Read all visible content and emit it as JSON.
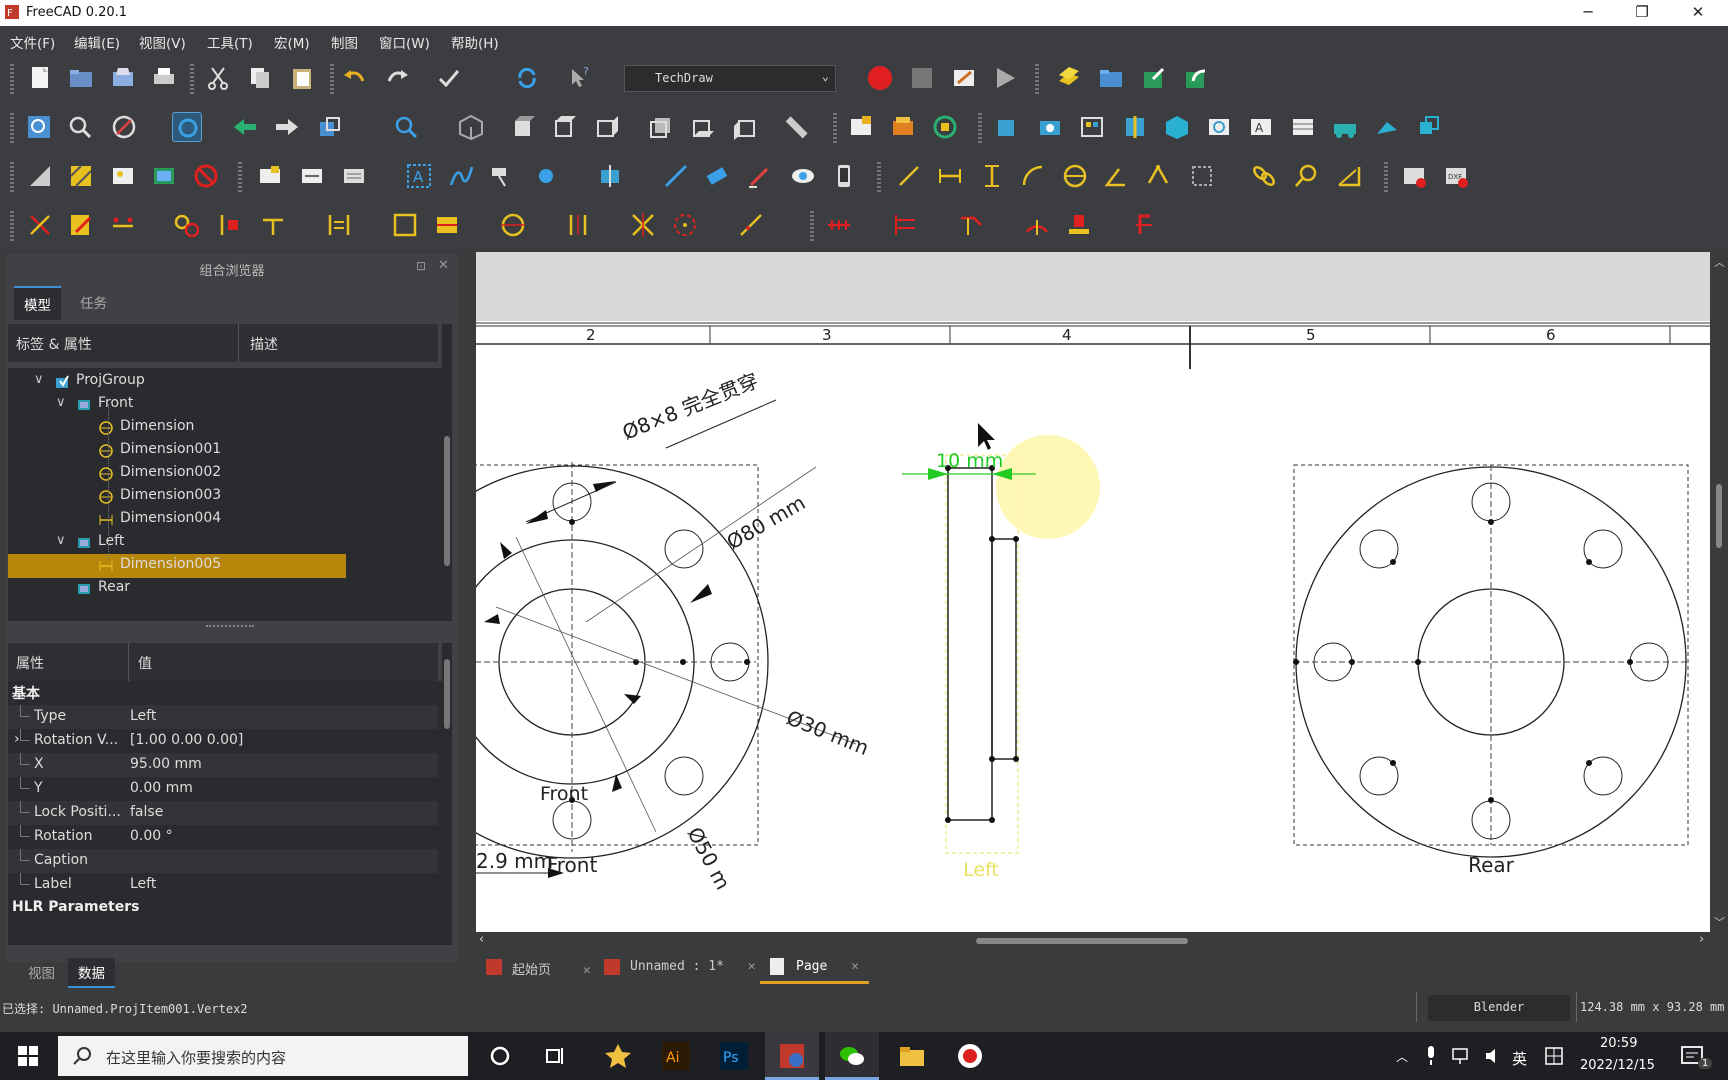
{
  "window": {
    "title": "FreeCAD 0.20.1",
    "min": "─",
    "max": "❐",
    "close": "✕"
  },
  "menu": [
    "文件(F)",
    "编辑(E)",
    "视图(V)",
    "工具(T)",
    "宏(M)",
    "制图",
    "窗口(W)",
    "帮助(H)"
  ],
  "toolbar": {
    "workbench": "TechDraw"
  },
  "combo": {
    "title": "组合浏览器",
    "tabs": [
      "模型",
      "任务"
    ],
    "tree_headers": [
      "标签 & 属性",
      "描述"
    ],
    "tree": [
      {
        "label": "ProjGroup",
        "level": 0,
        "expander": "∨",
        "icon": "projgroup-icon"
      },
      {
        "label": "Front",
        "level": 1,
        "expander": "∨",
        "icon": "view-icon"
      },
      {
        "label": "Dimension",
        "level": 2,
        "expander": "",
        "icon": "dimension-icon"
      },
      {
        "label": "Dimension001",
        "level": 2,
        "expander": "",
        "icon": "dimension-icon"
      },
      {
        "label": "Dimension002",
        "level": 2,
        "expander": "",
        "icon": "dimension-icon"
      },
      {
        "label": "Dimension003",
        "level": 2,
        "expander": "",
        "icon": "dimension-icon"
      },
      {
        "label": "Dimension004",
        "level": 2,
        "expander": "",
        "icon": "linear-dimension-icon"
      },
      {
        "label": "Left",
        "level": 1,
        "expander": "∨",
        "icon": "view-icon"
      },
      {
        "label": "Dimension005",
        "level": 2,
        "expander": "",
        "icon": "linear-dimension-icon",
        "selected": true
      },
      {
        "label": "Rear",
        "level": 1,
        "expander": "",
        "icon": "view-icon"
      }
    ],
    "prop_headers": [
      "属性",
      "值"
    ],
    "group_basic": "基本",
    "props": [
      {
        "name": "Type",
        "value": "Left"
      },
      {
        "name": "Rotation V...",
        "value": "[1.00 0.00 0.00]",
        "expander": "›"
      },
      {
        "name": "X",
        "value": "95.00 mm"
      },
      {
        "name": "Y",
        "value": "0.00 mm"
      },
      {
        "name": "Lock Positi...",
        "value": "false"
      },
      {
        "name": "Rotation",
        "value": "0.00 °"
      },
      {
        "name": "Caption",
        "value": ""
      },
      {
        "name": "Label",
        "value": "Left"
      }
    ],
    "group_hlr": "HLR Parameters",
    "bottom_tabs": [
      "视图",
      "数据"
    ]
  },
  "drawing": {
    "columns": [
      "2",
      "3",
      "4",
      "5",
      "6"
    ],
    "views": [
      "Front",
      "Left",
      "Rear"
    ],
    "dims": {
      "holes": "Ø8×8 完全贯穿",
      "d80": "Ø80 mm",
      "d30": "Ø30 mm",
      "d50": "Ø50 m",
      "d2_9": "2.9 mm",
      "t10": "10 mm"
    }
  },
  "doc_tabs": [
    "起始页",
    "Unnamed : 1*",
    "Page"
  ],
  "status": {
    "message": "已选择: Unnamed.ProjItem001.Vertex2",
    "nav": "Blender",
    "dims": "124.38 mm x 93.28 mm"
  },
  "taskbar": {
    "search": "在这里输入你要搜索的内容",
    "ime": "英",
    "time": "20:59",
    "date": "2022/12/15",
    "notif": "1"
  },
  "colors": {
    "accent": "#e0a020",
    "selection": "#b8860b",
    "dim_green": "#22cc22",
    "left_yellow": "#e8e060"
  }
}
